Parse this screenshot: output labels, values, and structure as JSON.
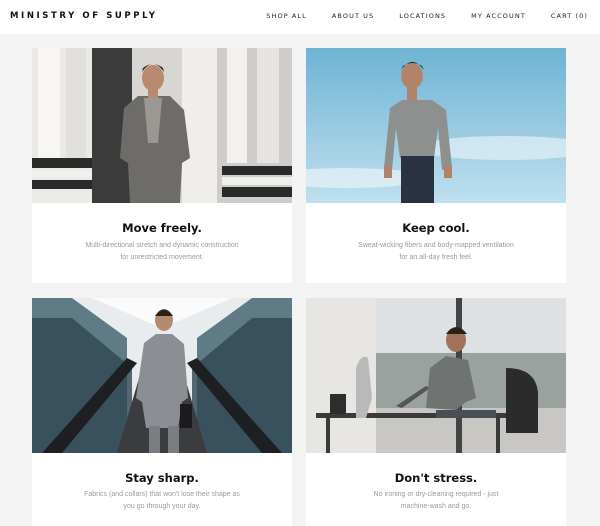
{
  "header": {
    "brand": "MINISTRY OF SUPPLY",
    "nav": [
      {
        "label": "SHOP ALL"
      },
      {
        "label": "ABOUT US"
      },
      {
        "label": "LOCATIONS"
      },
      {
        "label": "MY ACCOUNT"
      },
      {
        "label": "CART (0)"
      }
    ]
  },
  "features": [
    {
      "title": "Move freely.",
      "desc_line1": "Multi-directional stretch and dynamic construction",
      "desc_line2": "for unrestricted movement.",
      "image": "man-in-gray-suit-by-columns-photo"
    },
    {
      "title": "Keep cool.",
      "desc_line1": "Sweat-wicking fibers and body-mapped ventilation",
      "desc_line2": "for an all-day fresh feel.",
      "image": "man-in-shirt-against-sky-photo"
    },
    {
      "title": "Stay sharp.",
      "desc_line1": "Fabrics (and collars) that won't lose their shape as",
      "desc_line2": "you go through your day.",
      "image": "man-on-escalator-photo"
    },
    {
      "title": "Don't stress.",
      "desc_line1": "No ironing or dry-cleaning required - just",
      "desc_line2": "machine-wash and go.",
      "image": "man-working-at-desk-photo"
    }
  ]
}
